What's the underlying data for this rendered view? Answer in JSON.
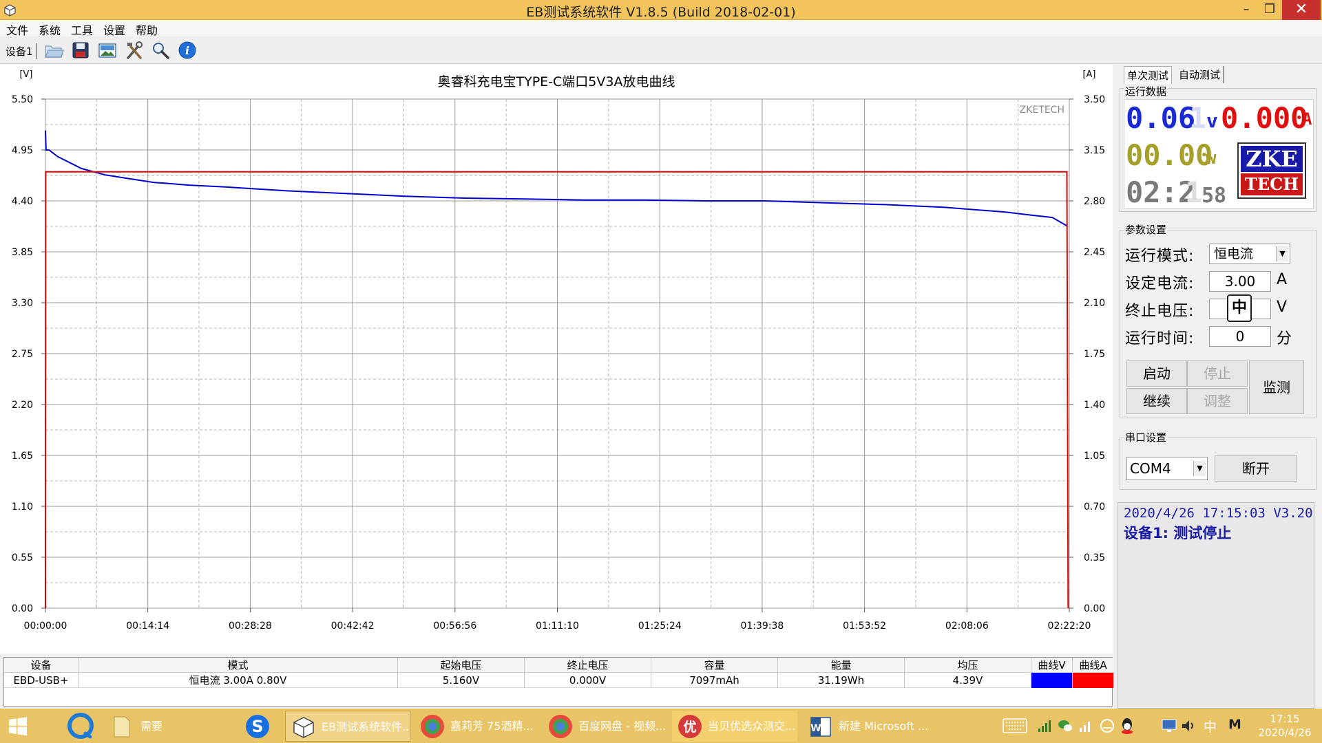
{
  "window": {
    "title": "EB测试系统软件 V1.8.5 (Build 2018-02-01)",
    "minimize_glyph": "–",
    "restore_glyph": "❐",
    "close_glyph": "✕"
  },
  "menu": [
    "文件",
    "系统",
    "工具",
    "设置",
    "帮助"
  ],
  "toolbar": {
    "device_tab": "设备1",
    "icons": [
      "open-folder-icon",
      "save-icon",
      "image-icon",
      "tools-icon",
      "zoom-icon",
      "info-icon"
    ]
  },
  "chart": {
    "title": "奥睿科充电宝TYPE-C端口5V3A放电曲线",
    "left_unit": "[V]",
    "right_unit": "[A]",
    "watermark": "ZKETECH",
    "left_ticks": [
      "5.50",
      "4.95",
      "4.40",
      "3.85",
      "3.30",
      "2.75",
      "2.20",
      "1.65",
      "1.10",
      "0.55",
      "0.00"
    ],
    "right_ticks": [
      "3.50",
      "3.15",
      "2.80",
      "2.45",
      "2.10",
      "1.75",
      "1.40",
      "1.05",
      "0.70",
      "0.35",
      "0.00"
    ],
    "x_ticks": [
      "00:00:00",
      "00:14:14",
      "00:28:28",
      "00:42:42",
      "00:56:56",
      "01:11:10",
      "01:25:24",
      "01:39:38",
      "01:53:52",
      "02:08:06",
      "02:22:20"
    ]
  },
  "chart_data": {
    "type": "line",
    "title": "奥睿科充电宝TYPE-C端口5V3A放电曲线",
    "xlabel": "",
    "ylabel": "[V]",
    "y2label": "[A]",
    "x_unit": "seconds",
    "xlim": [
      0,
      8540
    ],
    "ylim": [
      0,
      5.5
    ],
    "y2lim": [
      0,
      3.5
    ],
    "grid": true,
    "series": [
      {
        "axis": "left",
        "color": "#0000cc",
        "x": [
          0,
          5,
          30,
          100,
          300,
          500,
          700,
          900,
          1000,
          1200,
          1500,
          2000,
          2500,
          3000,
          3500,
          4000,
          4500,
          5000,
          5500,
          6000,
          6500,
          7000,
          7500,
          8000,
          8200,
          8400,
          8520
        ],
        "y": [
          5.16,
          4.95,
          4.95,
          4.88,
          4.75,
          4.68,
          4.64,
          4.6,
          4.59,
          4.57,
          4.55,
          4.51,
          4.48,
          4.45,
          4.43,
          4.42,
          4.41,
          4.41,
          4.4,
          4.4,
          4.38,
          4.36,
          4.33,
          4.28,
          4.25,
          4.22,
          4.13
        ]
      },
      {
        "axis": "right",
        "color": "#e00000",
        "x": [
          0,
          2,
          8500,
          8520,
          8530
        ],
        "y": [
          0,
          3.0,
          3.0,
          3.0,
          0
        ]
      }
    ]
  },
  "table": {
    "headers": [
      "设备",
      "模式",
      "起始电压",
      "终止电压",
      "容量",
      "能量",
      "均压",
      "曲线V",
      "曲线A"
    ],
    "row": [
      "EBD-USB+",
      "恒电流  3.00A  0.80V",
      "5.160V",
      "0.000V",
      "7097mAh",
      "31.19Wh",
      "4.39V",
      "",
      ""
    ],
    "curve_v_color": "#0000ff",
    "curve_a_color": "#ff0000"
  },
  "panel": {
    "tabs": [
      "单次测试",
      "自动测试"
    ],
    "runtime_group": "运行数据",
    "voltage_value": "0.06",
    "voltage_dim": "1",
    "voltage_unit": "v",
    "current_value": "0.000",
    "current_unit": "A",
    "power_value": "00.00",
    "power_unit": "w",
    "time_value": "02:2",
    "time_dim": "1",
    "time_seconds": "58",
    "logo_top": "ZKE",
    "logo_bottom": "TECH",
    "params_group": "参数设置",
    "mode_label": "运行模式:",
    "mode_value": "恒电流",
    "current_label": "设定电流:",
    "current_set": "3.00",
    "current_set_unit": "A",
    "cutoff_label": "终止电压:",
    "cutoff_value": "中",
    "cutoff_unit": "V",
    "runtime_label": "运行时间:",
    "runtime_value": "0",
    "runtime_unit": "分",
    "btn_start": "启动",
    "btn_stop": "停止",
    "btn_continue": "继续",
    "btn_adjust": "调整",
    "btn_monitor": "监测",
    "serial_group": "串口设置",
    "port_value": "COM4",
    "btn_disconnect": "断开",
    "status_line1": "2020/4/26 17:15:03  V3.20",
    "status_line2": "设备1: 测试停止"
  },
  "taskbar": {
    "items": [
      {
        "label": "需要",
        "icon": "folder-icon"
      },
      {
        "label": "",
        "icon": "sogou-icon"
      },
      {
        "label": "EB测试系统软件...",
        "icon": "eb-app-icon"
      },
      {
        "label": "嘉莉芳 75酒精...",
        "icon": "browser-icon"
      },
      {
        "label": "百度网盘 - 视频...",
        "icon": "browser-icon"
      },
      {
        "label": "当贝优选众测交...",
        "icon": "youku-icon"
      },
      {
        "label": "新建 Microsoft ...",
        "icon": "word-icon"
      }
    ],
    "ime": "中",
    "ime_mode": "M",
    "time": "17:15",
    "date": "2020/4/26"
  }
}
